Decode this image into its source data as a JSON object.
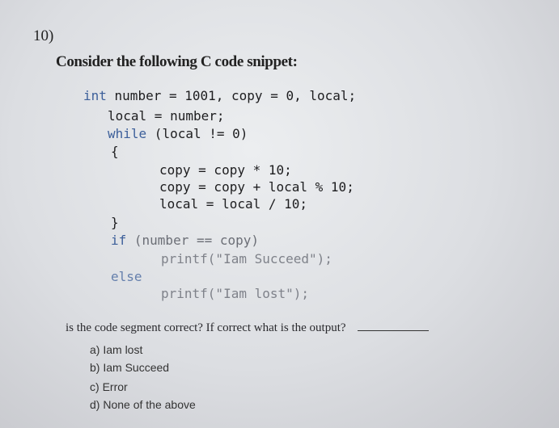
{
  "question_number": "10)",
  "heading": "Consider the following C code snippet:",
  "code": {
    "line1_kw": "int",
    "line1_rest": " number = 1001, copy = 0, local;",
    "line2": "local = number;",
    "line3_kw": "while",
    "line3_rest": " (local != 0)",
    "open_brace": "{",
    "line4": "copy = copy * 10;",
    "line5": "copy = copy + local % 10;",
    "line6": "local = local / 10;",
    "close_brace": "}",
    "if_kw": "if",
    "if_rest": " (number == copy)",
    "printf1": "printf(\"Iam Succeed\");",
    "else_kw": "else",
    "printf2": "printf(\"Iam lost\");"
  },
  "prompt": "is the code segment correct? If correct what is the output?",
  "options": [
    {
      "letter": "a)",
      "text": "Iam lost"
    },
    {
      "letter": "b)",
      "text": "Iam Succeed"
    },
    {
      "letter": "c)",
      "text": "Error"
    },
    {
      "letter": "d)",
      "text": "None of the above"
    }
  ]
}
